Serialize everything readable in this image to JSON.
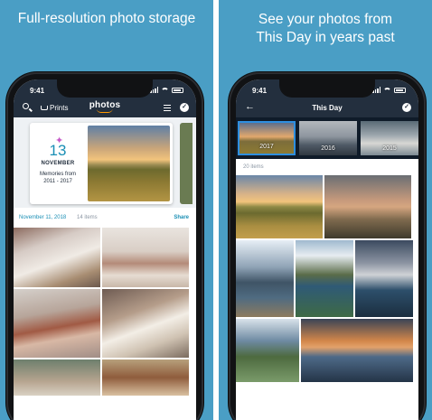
{
  "left_panel": {
    "caption": "Full-resolution photo storage",
    "status": {
      "time": "9:41"
    },
    "appbar": {
      "prints_label": "Prints",
      "logo_text": "photos",
      "check": "✓"
    },
    "memory": {
      "day": "13",
      "month": "NOVEMBER",
      "line1": "Memories from",
      "line2": "2011 - 2017"
    },
    "date_row": {
      "date": "November 11, 2018",
      "items": "14 items",
      "share": "Share"
    }
  },
  "right_panel": {
    "caption_line1": "See your photos from",
    "caption_line2": "This Day in years past",
    "status": {
      "time": "9:41"
    },
    "appbar": {
      "back": "←",
      "title": "This Day",
      "check": "✓"
    },
    "years": [
      "2017",
      "2016",
      "2015"
    ],
    "items_count": "20 items"
  },
  "colors": {
    "background": "#4a9ec5",
    "appbar": "#232f3e",
    "accent": "#1a8fb5",
    "logo_smile": "#ff9900"
  }
}
